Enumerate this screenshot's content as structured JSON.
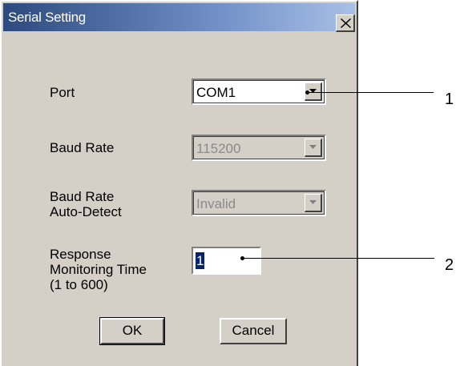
{
  "window": {
    "title": "Serial Setting",
    "close_glyph": "✕",
    "colors": {
      "face": "#d4d0c8",
      "title_gradient_start": "#2c4a7d",
      "title_gradient_end": "#a9c0e6",
      "selection": "#0a246a",
      "disabled_text": "#8a8a8a"
    }
  },
  "fields": {
    "port": {
      "label": "Port",
      "value": "COM1"
    },
    "baud_rate": {
      "label": "Baud Rate",
      "value": "115200"
    },
    "auto_detect": {
      "label_line1": "Baud Rate",
      "label_line2": "Auto-Detect",
      "value": "Invalid"
    },
    "response_time": {
      "label_line1": "Response",
      "label_line2": "Monitoring Time",
      "label_line3": "(1 to 600)",
      "value": "1"
    }
  },
  "buttons": {
    "ok": "OK",
    "cancel": "Cancel"
  },
  "callouts": {
    "one": "1",
    "two": "2"
  }
}
